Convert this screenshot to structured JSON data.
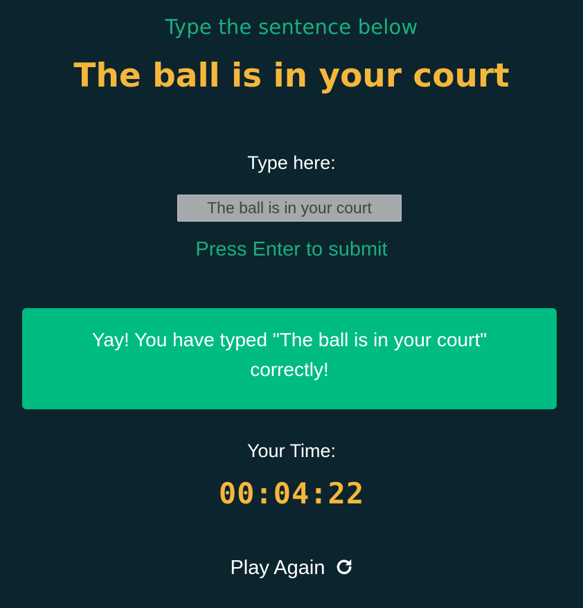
{
  "prompt": {
    "instruction": "Type the sentence below",
    "sentence": "The ball is in your court"
  },
  "input": {
    "label": "Type here:",
    "value": "The ball is in your court",
    "hint": "Press Enter to submit"
  },
  "result": {
    "message_line1": "Yay! You have typed \"The ball is in your court\"",
    "message_line2": "correctly!"
  },
  "timer": {
    "label": "Your Time:",
    "value": "00:04:22"
  },
  "actions": {
    "play_again_label": "Play Again",
    "play_again_icon": "refresh-icon"
  },
  "colors": {
    "background": "#0c242d",
    "accent_green": "#19b07f",
    "accent_yellow": "#f5b73b",
    "success_bg": "#00bc82"
  }
}
